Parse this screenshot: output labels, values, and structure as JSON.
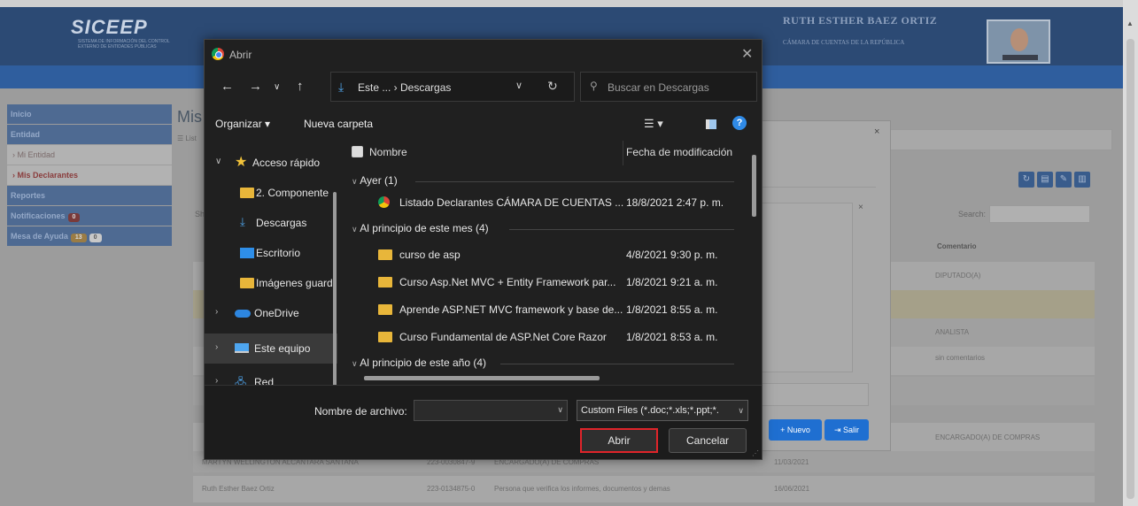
{
  "app": {
    "logo": "SICEEP",
    "logo_sub": "SISTEMA DE INFORMACIÓN DEL CONTROL EXTERNO DE ENTIDADES PÚBLICAS",
    "user_name": "RUTH ESTHER BAEZ ORTIZ",
    "user_org": "CÁMARA DE CUENTAS DE LA REPÚBLICA",
    "sidebar": {
      "items": [
        {
          "label": "Inicio"
        },
        {
          "label": "Entidad"
        },
        {
          "label": "› Mi Entidad"
        },
        {
          "label": "› Mis Declarantes"
        },
        {
          "label": "Reportes"
        },
        {
          "label": "Notificaciones",
          "badge": "0"
        },
        {
          "label": "Mesa de Ayuda",
          "badge": "13",
          "badge2": "0"
        }
      ]
    },
    "page_title": "Mis",
    "page_sub": "☰ List",
    "show_label": "Sh",
    "search_label": "Search:",
    "table": {
      "col_comentario": "Comentario",
      "comments": [
        "DIPUTADO(A)",
        "",
        "ANALISTA",
        "sin comentarios",
        "",
        "ENCARGADO(A) DE COMPRAS"
      ],
      "rows": [
        {
          "name": "MARTYN WELLINGTON ALCANTARA SANTANA",
          "id": "223-0030847-9",
          "role": "ENCARGADO(A) DE COMPRAS",
          "date": "11/03/2021"
        },
        {
          "name": "Ruth Esther Baez Ortiz",
          "id": "223-0134875-0",
          "role": "Persona que verifica los informes, documentos y demas",
          "date": "16/06/2021"
        }
      ]
    },
    "modal": {
      "close": "×",
      "nuevo_label": "+ Nuevo",
      "salir_label": "⇥ Salir"
    }
  },
  "dialog": {
    "title": "Abrir",
    "close": "✕",
    "address": {
      "path": "Este ...  ›  Descargas"
    },
    "search_placeholder": "Buscar en Descargas",
    "toolbar": {
      "organize": "Organizar ▾",
      "new_folder": "Nueva carpeta"
    },
    "nav": [
      {
        "label": "Acceso rápido",
        "icon": "star-icon"
      },
      {
        "label": "2. Componente",
        "icon": "folder-icon"
      },
      {
        "label": "Descargas",
        "icon": "download-icon"
      },
      {
        "label": "Escritorio",
        "icon": "desktop-icon"
      },
      {
        "label": "Imágenes guard",
        "icon": "folder-icon"
      },
      {
        "label": "OneDrive",
        "icon": "cloud-icon"
      },
      {
        "label": "Este equipo",
        "icon": "pc-icon"
      },
      {
        "label": "Red",
        "icon": "network-icon"
      }
    ],
    "columns": {
      "name": "Nombre",
      "date": "Fecha de modificación"
    },
    "groups": {
      "yesterday": "Ayer (1)",
      "this_month": "Al principio de este mes (4)",
      "this_year": "Al principio de este año (4)"
    },
    "files": [
      {
        "name": "Listado Declarantes CÁMARA DE CUENTAS ...",
        "date": "18/8/2021 2:47 p. m.",
        "icon": "chrome-icon"
      },
      {
        "name": "curso de asp",
        "date": "4/8/2021 9:30 p. m.",
        "icon": "folder-icon"
      },
      {
        "name": "Curso Asp.Net MVC + Entity Framework par...",
        "date": "1/8/2021 9:21 a. m.",
        "icon": "folder-icon"
      },
      {
        "name": "Aprende ASP.NET MVC framework y base de...",
        "date": "1/8/2021 8:55 a. m.",
        "icon": "folder-icon"
      },
      {
        "name": "Curso Fundamental de ASP.Net Core Razor",
        "date": "1/8/2021 8:53 a. m.",
        "icon": "folder-icon"
      }
    ],
    "filename_label": "Nombre de archivo:",
    "filename_value": "",
    "filter": "Custom Files (*.doc;*.xls;*.ppt;*.",
    "open_label": "Abrir",
    "cancel_label": "Cancelar"
  }
}
